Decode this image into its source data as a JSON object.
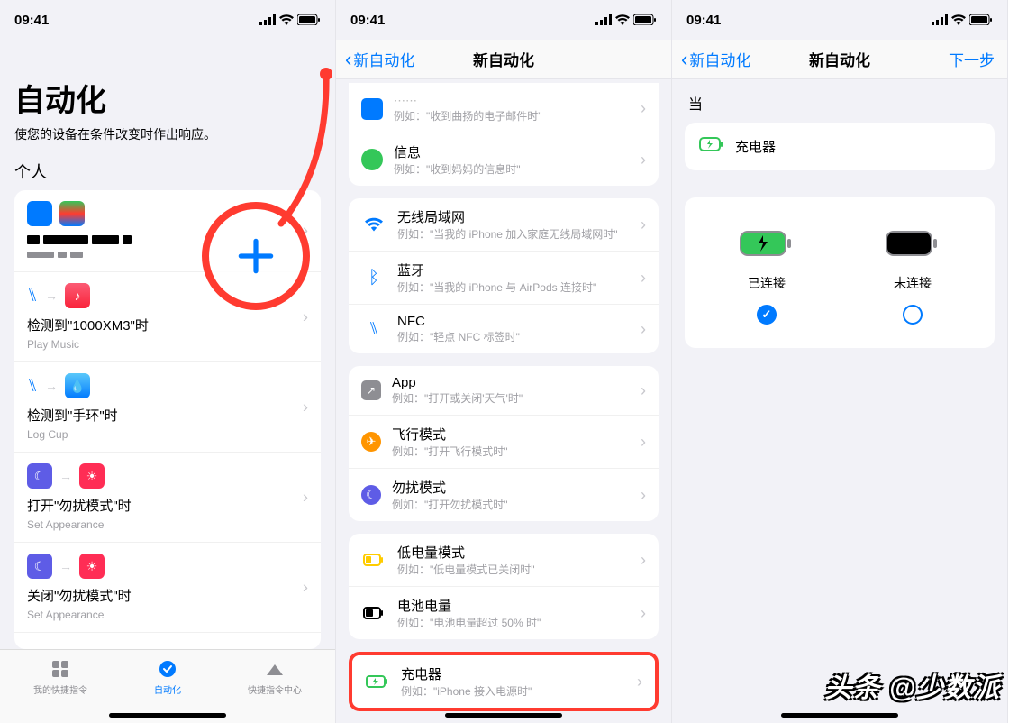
{
  "status": {
    "time": "09:41"
  },
  "screen1": {
    "title": "自动化",
    "subtitle": "使您的设备在条件改变时作出响应。",
    "section": "个人",
    "first_row_icons": true,
    "rows": [
      {
        "title": "检测到\"1000XM3\"时",
        "sub": "Play Music",
        "icons": [
          "bt",
          "arrow",
          "music"
        ]
      },
      {
        "title": "检测到\"手环\"时",
        "sub": "Log Cup",
        "icons": [
          "bt",
          "arrow",
          "water"
        ]
      },
      {
        "title": "打开\"勿扰模式\"时",
        "sub": "Set Appearance",
        "icons": [
          "moon",
          "arrow",
          "sun"
        ]
      },
      {
        "title": "关闭\"勿扰模式\"时",
        "sub": "Set Appearance",
        "icons": [
          "moon",
          "arrow",
          "sun"
        ]
      }
    ],
    "lastrow_icons": [
      "charge",
      "arrow",
      "note",
      "gear",
      "speak"
    ],
    "tabs": {
      "shortcuts": "我的快捷指令",
      "automation": "自动化",
      "gallery": "快捷指令中心"
    }
  },
  "screen2": {
    "back": "新自动化",
    "title": "新自动化",
    "group0": [
      {
        "icon": "mail",
        "h": "",
        "s": "例如：\"收到曲扬的电子邮件时\""
      },
      {
        "icon": "msg",
        "h": "信息",
        "s": "例如：\"收到妈妈的信息时\""
      }
    ],
    "group1": [
      {
        "icon": "wifi",
        "h": "无线局域网",
        "s": "例如：\"当我的 iPhone 加入家庭无线局域网时\""
      },
      {
        "icon": "bt",
        "h": "蓝牙",
        "s": "例如：\"当我的 iPhone 与 AirPods 连接时\""
      },
      {
        "icon": "nfc",
        "h": "NFC",
        "s": "例如：\"轻点 NFC 标签时\""
      }
    ],
    "group2": [
      {
        "icon": "app",
        "h": "App",
        "s": "例如：\"打开或关闭'天气'时\""
      },
      {
        "icon": "plane",
        "h": "飞行模式",
        "s": "例如：\"打开飞行模式时\""
      },
      {
        "icon": "dnd",
        "h": "勿扰模式",
        "s": "例如：\"打开勿扰模式时\""
      }
    ],
    "group3": [
      {
        "icon": "low",
        "h": "低电量模式",
        "s": "例如：\"低电量模式已关闭时\""
      },
      {
        "icon": "lvl",
        "h": "电池电量",
        "s": "例如：\"电池电量超过 50% 时\""
      }
    ],
    "charger": {
      "h": "充电器",
      "s": "例如：\"iPhone 接入电源时\""
    }
  },
  "screen3": {
    "back": "新自动化",
    "title": "新自动化",
    "next": "下一步",
    "when": "当",
    "trigger": "充电器",
    "opt_connected": "已连接",
    "opt_disconnected": "未连接"
  },
  "watermark": "头条 @少数派"
}
